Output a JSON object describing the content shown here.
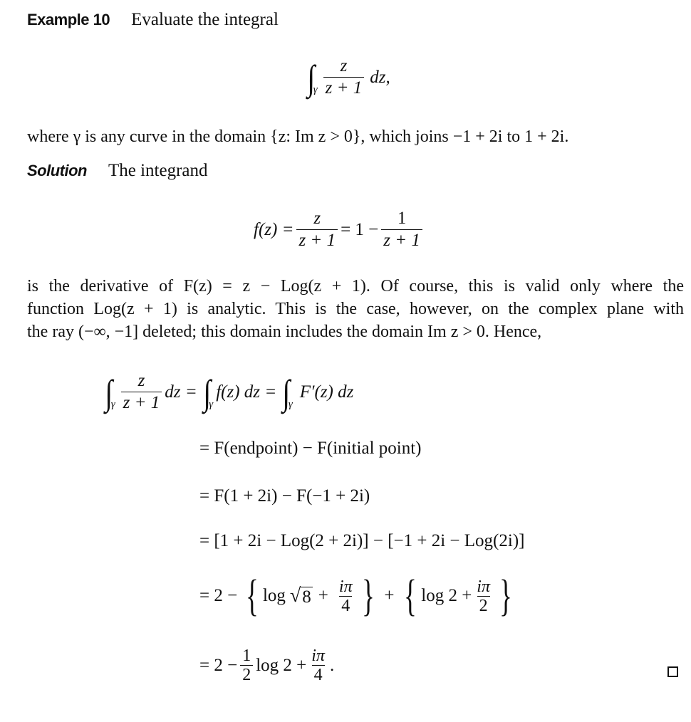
{
  "example": {
    "label": "Example 10",
    "intro": "Evaluate the integral"
  },
  "problem_integral": {
    "integral_sign": "∫",
    "subscript": "γ",
    "numerator": "z",
    "denominator": "z + 1",
    "differential": "dz,"
  },
  "condition_text": "where γ is any curve in the domain {z: Im z > 0}, which joins −1 + 2i to 1 + 2i.",
  "solution": {
    "label": "Solution",
    "intro": "The integrand"
  },
  "integrand_eq": {
    "lhs": "f(z) =",
    "frac1_num": "z",
    "frac1_den": "z + 1",
    "mid": "= 1 −",
    "frac2_num": "1",
    "frac2_den": "z + 1"
  },
  "paragraph": [
    "is the derivative of F(z) = z − Log(z + 1). Of course, this is valid only where the",
    "function Log(z + 1) is analytic. This is the case, however, on the complex plane with",
    "the ray (−∞, −1] deleted; this domain includes the domain Im z > 0. Hence,"
  ],
  "chain": {
    "line1": {
      "int1_num": "z",
      "int1_den": "z + 1",
      "int1_diff": "dz",
      "eq1": "=",
      "int2_body": "f(z) dz",
      "eq2": "=",
      "int3_body": "F′(z) dz",
      "subscript": "γ",
      "integral_sign": "∫"
    },
    "line2": "= F(endpoint) − F(initial point)",
    "line3": "= F(1 + 2i) − F(−1 + 2i)",
    "line4": "= [1 + 2i − Log(2 + 2i)] − [−1 + 2i − Log(2i)]",
    "line5": {
      "prefix": "= 2 −",
      "brace_open": "{",
      "brace_close": "}",
      "log1": "log",
      "sqrt_sign": "√",
      "sqrt_arg": "8",
      "plus": "+",
      "frac1_num": "iπ",
      "frac1_den": "4",
      "between": "+",
      "log2": "log 2 +",
      "frac2_num": "iπ",
      "frac2_den": "2"
    },
    "line6": {
      "prefix": "= 2 −",
      "frac1_num": "1",
      "frac1_den": "2",
      "mid": "log 2 +",
      "frac2_num": "iπ",
      "frac2_den": "4",
      "suffix": "."
    }
  },
  "end_mark": "qed-square"
}
